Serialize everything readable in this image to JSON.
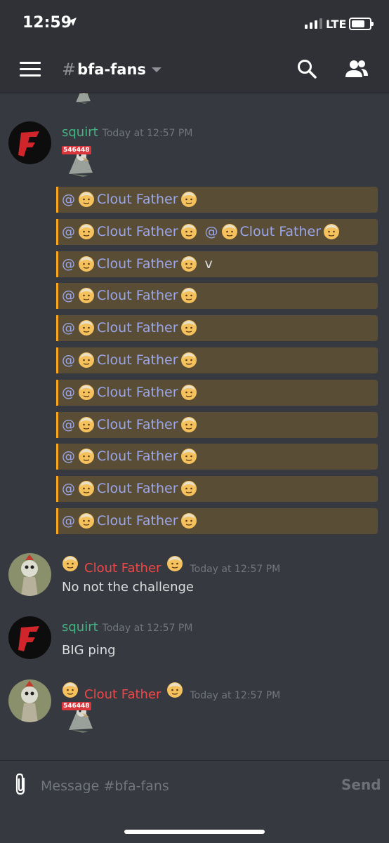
{
  "status_bar": {
    "time": "12:59",
    "network": "LTE"
  },
  "header": {
    "channel_name": "bfa-fans"
  },
  "messages": [
    {
      "author": "squirt",
      "timestamp": "Today at 12:57 PM",
      "sticker_badge": "546448"
    },
    {
      "mentions": [
        {
          "parts": [
            "Clout Father"
          ],
          "trail": ""
        },
        {
          "parts": [
            "Clout Father",
            "Clout Father"
          ],
          "trail": ""
        },
        {
          "parts": [
            "Clout Father"
          ],
          "trail": "v"
        },
        {
          "parts": [
            "Clout Father"
          ],
          "trail": ""
        },
        {
          "parts": [
            "Clout Father"
          ],
          "trail": ""
        },
        {
          "parts": [
            "Clout Father"
          ],
          "trail": ""
        },
        {
          "parts": [
            "Clout Father"
          ],
          "trail": ""
        },
        {
          "parts": [
            "Clout Father"
          ],
          "trail": ""
        },
        {
          "parts": [
            "Clout Father"
          ],
          "trail": ""
        },
        {
          "parts": [
            "Clout Father"
          ],
          "trail": ""
        },
        {
          "parts": [
            "Clout Father"
          ],
          "trail": ""
        }
      ]
    },
    {
      "author": "Clout Father",
      "timestamp": "Today at 12:57 PM",
      "text": "No not the challenge"
    },
    {
      "author": "squirt",
      "timestamp": "Today at 12:57 PM",
      "text": "BIG ping"
    },
    {
      "author": "Clout Father",
      "timestamp": "Today at 12:57 PM",
      "sticker_badge": "546448"
    }
  ],
  "composer": {
    "placeholder": "Message #bfa-fans",
    "send_label": "Send"
  },
  "colors": {
    "background": "#36393f",
    "mention_bg": "#5a4d36",
    "mention_border": "#faa61a",
    "mention_text": "#9aa6e8",
    "name_green": "#43b581",
    "name_red": "#f04747"
  }
}
